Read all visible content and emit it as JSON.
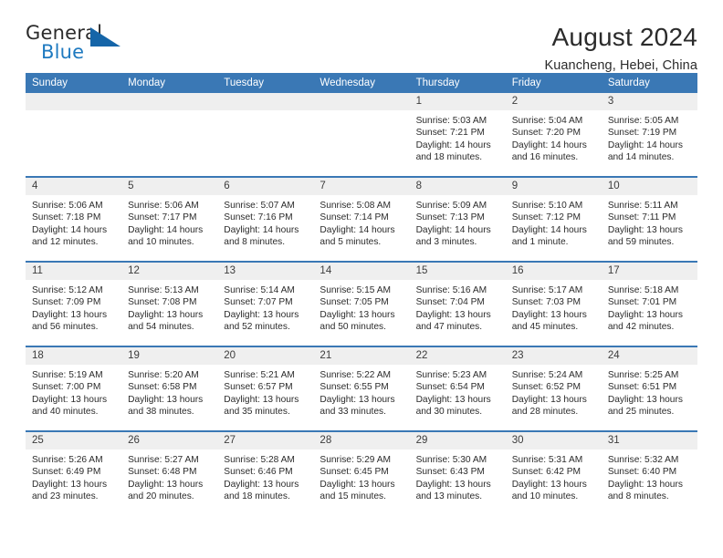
{
  "brand": {
    "name_top": "General",
    "name_bottom": "Blue"
  },
  "header": {
    "title": "August 2024",
    "subtitle": "Kuancheng, Hebei, China"
  },
  "columns": [
    "Sunday",
    "Monday",
    "Tuesday",
    "Wednesday",
    "Thursday",
    "Friday",
    "Saturday"
  ],
  "colors": {
    "header_blue": "#3a78b5",
    "daynum_gray": "#efefef",
    "brand_blue": "#1f7ac0",
    "text": "#2b2b2b"
  },
  "labels": {
    "sunrise_prefix": "Sunrise:",
    "sunset_prefix": "Sunset:",
    "daylight_prefix": "Daylight:"
  },
  "weeks": [
    [
      {
        "day": "",
        "sunrise": "",
        "sunset": "",
        "daylight": ""
      },
      {
        "day": "",
        "sunrise": "",
        "sunset": "",
        "daylight": ""
      },
      {
        "day": "",
        "sunrise": "",
        "sunset": "",
        "daylight": ""
      },
      {
        "day": "",
        "sunrise": "",
        "sunset": "",
        "daylight": ""
      },
      {
        "day": "1",
        "sunrise": "Sunrise: 5:03 AM",
        "sunset": "Sunset: 7:21 PM",
        "daylight": "Daylight: 14 hours and 18 minutes."
      },
      {
        "day": "2",
        "sunrise": "Sunrise: 5:04 AM",
        "sunset": "Sunset: 7:20 PM",
        "daylight": "Daylight: 14 hours and 16 minutes."
      },
      {
        "day": "3",
        "sunrise": "Sunrise: 5:05 AM",
        "sunset": "Sunset: 7:19 PM",
        "daylight": "Daylight: 14 hours and 14 minutes."
      }
    ],
    [
      {
        "day": "4",
        "sunrise": "Sunrise: 5:06 AM",
        "sunset": "Sunset: 7:18 PM",
        "daylight": "Daylight: 14 hours and 12 minutes."
      },
      {
        "day": "5",
        "sunrise": "Sunrise: 5:06 AM",
        "sunset": "Sunset: 7:17 PM",
        "daylight": "Daylight: 14 hours and 10 minutes."
      },
      {
        "day": "6",
        "sunrise": "Sunrise: 5:07 AM",
        "sunset": "Sunset: 7:16 PM",
        "daylight": "Daylight: 14 hours and 8 minutes."
      },
      {
        "day": "7",
        "sunrise": "Sunrise: 5:08 AM",
        "sunset": "Sunset: 7:14 PM",
        "daylight": "Daylight: 14 hours and 5 minutes."
      },
      {
        "day": "8",
        "sunrise": "Sunrise: 5:09 AM",
        "sunset": "Sunset: 7:13 PM",
        "daylight": "Daylight: 14 hours and 3 minutes."
      },
      {
        "day": "9",
        "sunrise": "Sunrise: 5:10 AM",
        "sunset": "Sunset: 7:12 PM",
        "daylight": "Daylight: 14 hours and 1 minute."
      },
      {
        "day": "10",
        "sunrise": "Sunrise: 5:11 AM",
        "sunset": "Sunset: 7:11 PM",
        "daylight": "Daylight: 13 hours and 59 minutes."
      }
    ],
    [
      {
        "day": "11",
        "sunrise": "Sunrise: 5:12 AM",
        "sunset": "Sunset: 7:09 PM",
        "daylight": "Daylight: 13 hours and 56 minutes."
      },
      {
        "day": "12",
        "sunrise": "Sunrise: 5:13 AM",
        "sunset": "Sunset: 7:08 PM",
        "daylight": "Daylight: 13 hours and 54 minutes."
      },
      {
        "day": "13",
        "sunrise": "Sunrise: 5:14 AM",
        "sunset": "Sunset: 7:07 PM",
        "daylight": "Daylight: 13 hours and 52 minutes."
      },
      {
        "day": "14",
        "sunrise": "Sunrise: 5:15 AM",
        "sunset": "Sunset: 7:05 PM",
        "daylight": "Daylight: 13 hours and 50 minutes."
      },
      {
        "day": "15",
        "sunrise": "Sunrise: 5:16 AM",
        "sunset": "Sunset: 7:04 PM",
        "daylight": "Daylight: 13 hours and 47 minutes."
      },
      {
        "day": "16",
        "sunrise": "Sunrise: 5:17 AM",
        "sunset": "Sunset: 7:03 PM",
        "daylight": "Daylight: 13 hours and 45 minutes."
      },
      {
        "day": "17",
        "sunrise": "Sunrise: 5:18 AM",
        "sunset": "Sunset: 7:01 PM",
        "daylight": "Daylight: 13 hours and 42 minutes."
      }
    ],
    [
      {
        "day": "18",
        "sunrise": "Sunrise: 5:19 AM",
        "sunset": "Sunset: 7:00 PM",
        "daylight": "Daylight: 13 hours and 40 minutes."
      },
      {
        "day": "19",
        "sunrise": "Sunrise: 5:20 AM",
        "sunset": "Sunset: 6:58 PM",
        "daylight": "Daylight: 13 hours and 38 minutes."
      },
      {
        "day": "20",
        "sunrise": "Sunrise: 5:21 AM",
        "sunset": "Sunset: 6:57 PM",
        "daylight": "Daylight: 13 hours and 35 minutes."
      },
      {
        "day": "21",
        "sunrise": "Sunrise: 5:22 AM",
        "sunset": "Sunset: 6:55 PM",
        "daylight": "Daylight: 13 hours and 33 minutes."
      },
      {
        "day": "22",
        "sunrise": "Sunrise: 5:23 AM",
        "sunset": "Sunset: 6:54 PM",
        "daylight": "Daylight: 13 hours and 30 minutes."
      },
      {
        "day": "23",
        "sunrise": "Sunrise: 5:24 AM",
        "sunset": "Sunset: 6:52 PM",
        "daylight": "Daylight: 13 hours and 28 minutes."
      },
      {
        "day": "24",
        "sunrise": "Sunrise: 5:25 AM",
        "sunset": "Sunset: 6:51 PM",
        "daylight": "Daylight: 13 hours and 25 minutes."
      }
    ],
    [
      {
        "day": "25",
        "sunrise": "Sunrise: 5:26 AM",
        "sunset": "Sunset: 6:49 PM",
        "daylight": "Daylight: 13 hours and 23 minutes."
      },
      {
        "day": "26",
        "sunrise": "Sunrise: 5:27 AM",
        "sunset": "Sunset: 6:48 PM",
        "daylight": "Daylight: 13 hours and 20 minutes."
      },
      {
        "day": "27",
        "sunrise": "Sunrise: 5:28 AM",
        "sunset": "Sunset: 6:46 PM",
        "daylight": "Daylight: 13 hours and 18 minutes."
      },
      {
        "day": "28",
        "sunrise": "Sunrise: 5:29 AM",
        "sunset": "Sunset: 6:45 PM",
        "daylight": "Daylight: 13 hours and 15 minutes."
      },
      {
        "day": "29",
        "sunrise": "Sunrise: 5:30 AM",
        "sunset": "Sunset: 6:43 PM",
        "daylight": "Daylight: 13 hours and 13 minutes."
      },
      {
        "day": "30",
        "sunrise": "Sunrise: 5:31 AM",
        "sunset": "Sunset: 6:42 PM",
        "daylight": "Daylight: 13 hours and 10 minutes."
      },
      {
        "day": "31",
        "sunrise": "Sunrise: 5:32 AM",
        "sunset": "Sunset: 6:40 PM",
        "daylight": "Daylight: 13 hours and 8 minutes."
      }
    ]
  ]
}
